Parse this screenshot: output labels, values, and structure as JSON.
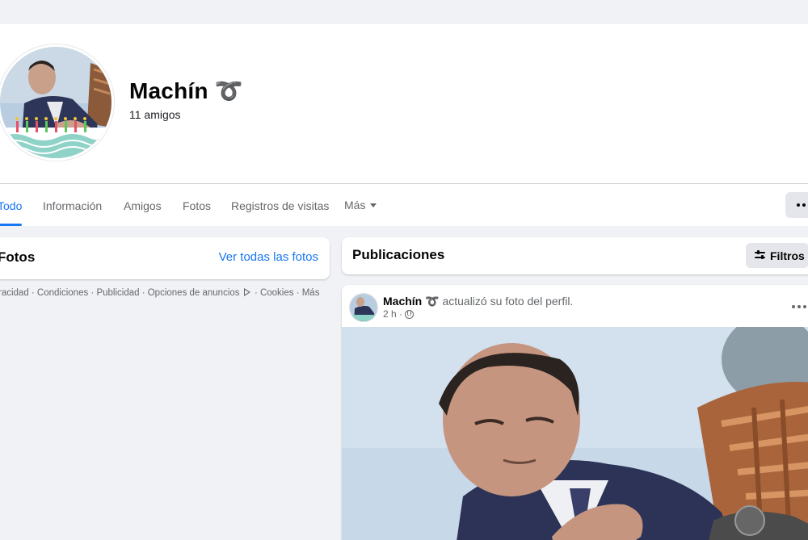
{
  "profile": {
    "name": "Machín ➰",
    "friends": "11 amigos"
  },
  "tabs": [
    {
      "label": "Todo",
      "active": true
    },
    {
      "label": "Información"
    },
    {
      "label": "Amigos"
    },
    {
      "label": "Fotos"
    },
    {
      "label": "Registros de visitas"
    },
    {
      "label": "Más"
    }
  ],
  "photos": {
    "title": "Fotos",
    "link": "Ver todas las fotos"
  },
  "footer": {
    "links": [
      "Privacidad",
      "Condiciones",
      "Publicidad",
      "Opciones de anuncios",
      "Cookies",
      "Más"
    ],
    "text_before_icon": "racidad · Condiciones · Publicidad · Opciones de anuncios",
    "text_after_icon": "· Cookies · Más"
  },
  "posts": {
    "title": "Publicaciones",
    "filter_label": "Filtros"
  },
  "post": {
    "author": "Machín ➰",
    "action": "actualizó su foto del perfil.",
    "time": "2 h ·"
  },
  "icons": {
    "more": "more-horizontal-icon",
    "filter": "sliders-icon",
    "privacy": "globe-icon",
    "ad_choices": "ad-choices-icon"
  },
  "colors": {
    "accent": "#1877f2",
    "page_bg": "#f0f2f5",
    "card_bg": "#ffffff",
    "secondary_text": "#65676b",
    "button_bg": "#e4e6eb"
  }
}
